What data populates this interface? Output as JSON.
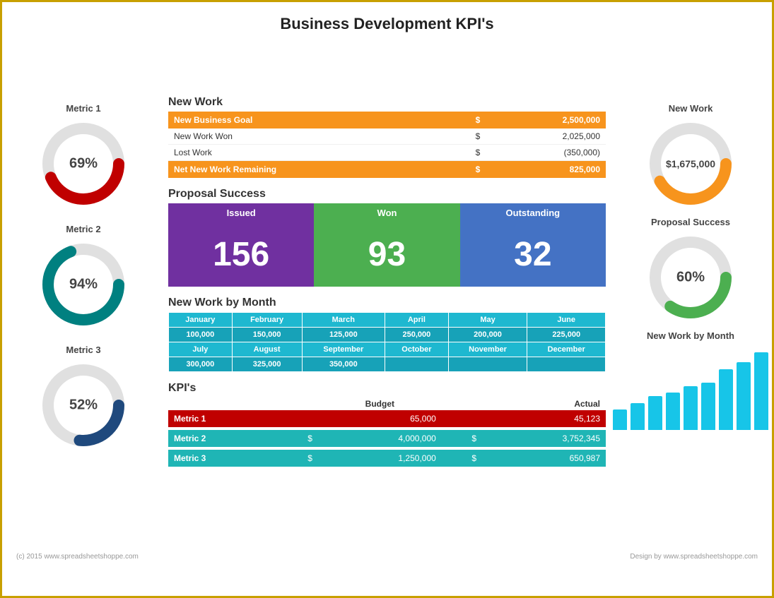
{
  "title": "Business Development KPI's",
  "left": {
    "metrics": [
      {
        "label": "Metric 1",
        "value": "69%",
        "color": "#c00000",
        "pct": 69
      },
      {
        "label": "Metric 2",
        "value": "94%",
        "color": "#008080",
        "pct": 94
      },
      {
        "label": "Metric 3",
        "value": "52%",
        "color": "#1f497d",
        "pct": 52
      }
    ]
  },
  "new_work": {
    "title": "New Work",
    "rows": [
      {
        "label": "New Business Goal",
        "dollar": "$",
        "amount": "2,500,000",
        "type": "highlight"
      },
      {
        "label": "New Work Won",
        "dollar": "$",
        "amount": "2,025,000",
        "type": "normal"
      },
      {
        "label": "Lost Work",
        "dollar": "$",
        "amount": "(350,000)",
        "type": "normal"
      },
      {
        "label": "Net New Work Remaining",
        "dollar": "$",
        "amount": "825,000",
        "type": "highlight"
      }
    ]
  },
  "proposal_success": {
    "title": "Proposal Success",
    "issued": {
      "label": "Issued",
      "value": "156"
    },
    "won": {
      "label": "Won",
      "value": "93"
    },
    "outstanding": {
      "label": "Outstanding",
      "value": "32"
    }
  },
  "new_work_by_month": {
    "title": "New Work by Month",
    "rows": [
      [
        {
          "label": "January",
          "value": "100,000"
        },
        {
          "label": "February",
          "value": "150,000"
        },
        {
          "label": "March",
          "value": "125,000"
        },
        {
          "label": "April",
          "value": "250,000"
        },
        {
          "label": "May",
          "value": "200,000"
        },
        {
          "label": "June",
          "value": "225,000"
        }
      ],
      [
        {
          "label": "July",
          "value": "300,000"
        },
        {
          "label": "August",
          "value": "325,000"
        },
        {
          "label": "September",
          "value": "350,000"
        },
        {
          "label": "October",
          "value": ""
        },
        {
          "label": "November",
          "value": ""
        },
        {
          "label": "December",
          "value": ""
        }
      ]
    ]
  },
  "kpis": {
    "title": "KPI's",
    "headers": [
      "",
      "Budget",
      "",
      "Actual"
    ],
    "rows": [
      {
        "label": "Metric 1",
        "dollar_b": "",
        "budget": "65,000",
        "dollar_a": "",
        "actual": "45,123",
        "type": "red"
      },
      {
        "label": "Metric 2",
        "dollar_b": "$",
        "budget": "4,000,000",
        "dollar_a": "$",
        "actual": "3,752,345",
        "type": "teal"
      },
      {
        "label": "Metric 3",
        "dollar_b": "$",
        "budget": "1,250,000",
        "dollar_a": "$",
        "actual": "650,987",
        "type": "teal"
      }
    ]
  },
  "right": {
    "new_work": {
      "title": "New Work",
      "value": "$1,675,000",
      "color": "#f7941d",
      "pct": 67
    },
    "proposal_success": {
      "title": "Proposal Success",
      "value": "60%",
      "color": "#4caf50",
      "pct": 60
    },
    "new_work_by_month": {
      "title": "New Work by Month",
      "bars": [
        30,
        40,
        50,
        55,
        65,
        70,
        90,
        100,
        115
      ]
    }
  },
  "footer": {
    "left": "(c) 2015 www.spreadsheetshoppe.com",
    "right": "Design by www.spreadsheetshoppe.com"
  }
}
